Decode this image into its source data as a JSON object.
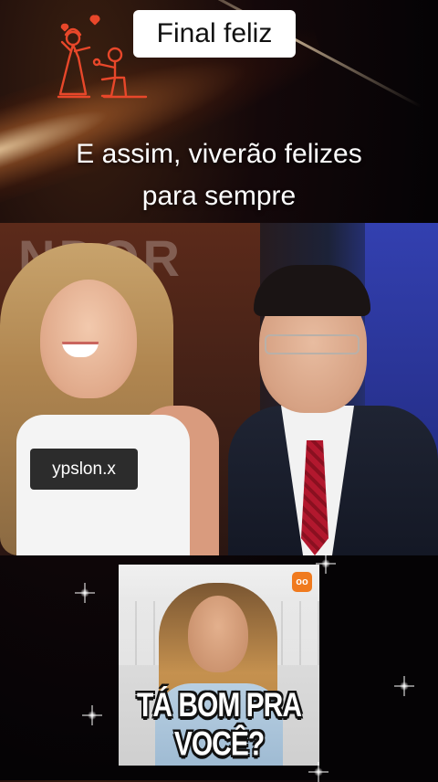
{
  "overlay": {
    "title_chip": "Final feliz",
    "caption_line1": "E assim, viverão felizes",
    "caption_line2": "para sempre",
    "watermark_handle": "ypslon.x"
  },
  "video": {
    "background_letters": "NDOR"
  },
  "sticker": {
    "headline": "TÁ BOM PRA VOCÊ?",
    "logo_glyph": "oo"
  },
  "icons": {
    "couple_proposal": "couple-proposal-icon",
    "sparkle": "sparkle-icon"
  },
  "colors": {
    "icon_accent": "#e8472a",
    "chip_bg": "#ffffff",
    "watermark_bg": "#000000",
    "sticker_logo": "#f07a1e"
  }
}
